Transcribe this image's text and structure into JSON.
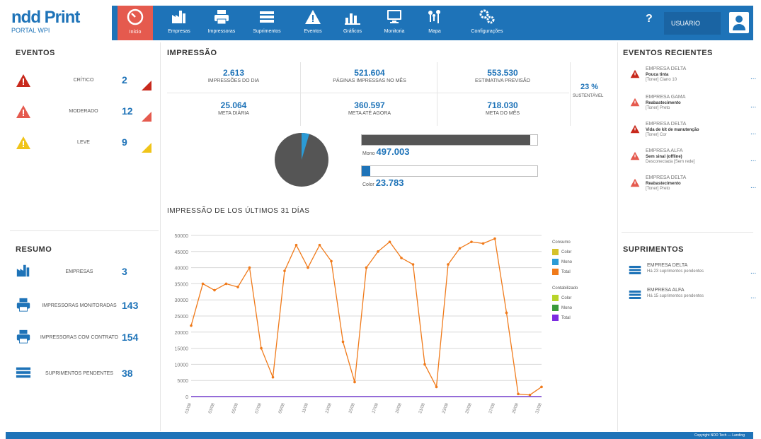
{
  "header": {
    "logo": "ndd Print",
    "logo_sub": "PORTAL WPI",
    "home_label": "Início",
    "nav": [
      {
        "label": "Empresas"
      },
      {
        "label": "Impressoras"
      },
      {
        "label": "Suprimentos"
      },
      {
        "label": "Eventos"
      },
      {
        "label": "Gráficos"
      },
      {
        "label": "Monitoria"
      },
      {
        "label": "Mapa"
      },
      {
        "label": "Configurações"
      }
    ],
    "help": "?",
    "user": "USUÁRIO"
  },
  "eventos": {
    "title": "EVENTOS",
    "rows": [
      {
        "label": "CRÍTICO",
        "count": "2",
        "color": "#c8291c"
      },
      {
        "label": "MODERADO",
        "count": "12",
        "color": "#e55a4e"
      },
      {
        "label": "LEVE",
        "count": "9",
        "color": "#f0c419"
      }
    ]
  },
  "resumo": {
    "title": "RESUMO",
    "rows": [
      {
        "label": "EMPRESAS",
        "count": "3"
      },
      {
        "label": "IMPRESSORAS MONITORADAS",
        "count": "143"
      },
      {
        "label": "IMPRESSORAS COM CONTRATO",
        "count": "154"
      },
      {
        "label": "SUPRIMENTOS PENDENTES",
        "count": "38"
      }
    ]
  },
  "impressao": {
    "title": "IMPRESSÃO",
    "stats": [
      {
        "value": "2.613",
        "label": "IMPRESSÕES DO DIA"
      },
      {
        "value": "521.604",
        "label": "PÁGINAS IMPRESSAS NO MÊS"
      },
      {
        "value": "553.530",
        "label": "ESTIMATIVA PREVISÃO"
      },
      {
        "value": "25.064",
        "label": "META DIÁRIA"
      },
      {
        "value": "360.597",
        "label": "META ATÉ AGORA"
      },
      {
        "value": "718.030",
        "label": "META DO MÊS"
      }
    ],
    "sust_value": "23 %",
    "sust_label": "SUSTENTÁVEL",
    "pie": {
      "mono_pct": 95.4,
      "color_pct": 4.6
    },
    "bars": [
      {
        "prefix": "Mono",
        "value": "497.003",
        "fill_pct": 96,
        "color": "#555555"
      },
      {
        "prefix": "Color",
        "value": "23.783",
        "fill_pct": 5,
        "color": "#1e73b8"
      }
    ]
  },
  "chart_data": {
    "type": "line",
    "title": "IMPRESSÃO DE LOS ÚLTIMOS 31 DÍAS",
    "ylim": [
      0,
      50000
    ],
    "yticks": [
      0,
      5000,
      10000,
      15000,
      20000,
      25000,
      30000,
      35000,
      40000,
      45000,
      50000
    ],
    "x": [
      "01/08",
      "02/08",
      "03/08",
      "04/08",
      "05/08",
      "06/08",
      "07/08",
      "08/08",
      "09/08",
      "10/08",
      "11/08",
      "12/08",
      "13/08",
      "14/08",
      "15/08",
      "16/08",
      "17/08",
      "18/08",
      "19/08",
      "20/08",
      "21/08",
      "22/08",
      "23/08",
      "24/08",
      "25/08",
      "26/08",
      "27/08",
      "28/08",
      "29/08",
      "30/08",
      "31/08"
    ],
    "xtick_labels": [
      "01/08",
      "03/08",
      "05/08",
      "07/08",
      "09/08",
      "11/08",
      "13/08",
      "15/08",
      "17/08",
      "19/08",
      "21/08",
      "23/08",
      "25/08",
      "27/08",
      "29/08",
      "31/08"
    ],
    "legend_title_1": "Consumo",
    "legend_title_2": "Contabilizado",
    "series": [
      {
        "name": "Total",
        "color": "#f07a1a",
        "values": [
          22000,
          35000,
          33000,
          35000,
          34000,
          40000,
          15000,
          6000,
          39000,
          47000,
          40000,
          47000,
          42000,
          17000,
          4500,
          40000,
          45000,
          48000,
          43000,
          41000,
          10000,
          3000,
          41000,
          46000,
          48000,
          47500,
          49000,
          26000,
          800,
          500,
          3000
        ]
      },
      {
        "name": "Color",
        "color": "#d5c12a",
        "values": [
          0,
          0,
          0,
          0,
          0,
          0,
          0,
          0,
          0,
          0,
          0,
          0,
          0,
          0,
          0,
          0,
          0,
          0,
          0,
          0,
          0,
          0,
          0,
          0,
          0,
          0,
          0,
          0,
          0,
          0,
          0
        ]
      },
      {
        "name": "Mono",
        "color": "#2b9bd6",
        "values": [
          0,
          0,
          0,
          0,
          0,
          0,
          0,
          0,
          0,
          0,
          0,
          0,
          0,
          0,
          0,
          0,
          0,
          0,
          0,
          0,
          0,
          0,
          0,
          0,
          0,
          0,
          0,
          0,
          0,
          0,
          0
        ]
      },
      {
        "name": "Total",
        "color": "#7b2be0",
        "values": [
          0,
          0,
          0,
          0,
          0,
          0,
          0,
          0,
          0,
          0,
          0,
          0,
          0,
          0,
          0,
          0,
          0,
          0,
          0,
          0,
          0,
          0,
          0,
          0,
          0,
          0,
          0,
          0,
          0,
          0,
          0
        ]
      }
    ],
    "legend": [
      {
        "group": 1,
        "name": "Color",
        "color": "#d5c12a"
      },
      {
        "group": 1,
        "name": "Mono",
        "color": "#2b9bd6"
      },
      {
        "group": 1,
        "name": "Total",
        "color": "#f07a1a"
      },
      {
        "group": 2,
        "name": "Color",
        "color": "#b8d42a"
      },
      {
        "group": 2,
        "name": "Mono",
        "color": "#3a9a3a"
      },
      {
        "group": 2,
        "name": "Total",
        "color": "#7b2be0"
      }
    ]
  },
  "eventos_recentes": {
    "title": "EVENTOS RECIENTES",
    "items": [
      {
        "company": "EMPRESA DELTA",
        "type": "Pouca tinta",
        "meta": "[Toner] Ciano 10",
        "color": "#c8291c"
      },
      {
        "company": "EMPRESA GAMA",
        "type": "Reabastecimento",
        "meta": "[Toner] Preto",
        "color": "#e55a4e"
      },
      {
        "company": "EMPRESA DELTA",
        "type": "Vida de kit de manutenção",
        "meta": "[Toner] Cor",
        "color": "#c8291c"
      },
      {
        "company": "EMPRESA ALFA",
        "type": "Sem sinal (offline)",
        "meta": "Desconectada [Sem rede]",
        "color": "#e55a4e"
      },
      {
        "company": "EMPRESA DELTA",
        "type": "Reabastecimento",
        "meta": "[Toner] Preto",
        "color": "#e55a4e"
      }
    ],
    "more": "..."
  },
  "suprimentos": {
    "title": "SUPRIMENTOS",
    "items": [
      {
        "company": "EMPRESA DELTA",
        "desc": "Há 23 suprimentos pendentes"
      },
      {
        "company": "EMPRESA ALFA",
        "desc": "Há 15 suprimentos pendentes"
      }
    ],
    "more": "..."
  },
  "footer": {
    "text": "Copyright NDD Tech — Landing"
  }
}
